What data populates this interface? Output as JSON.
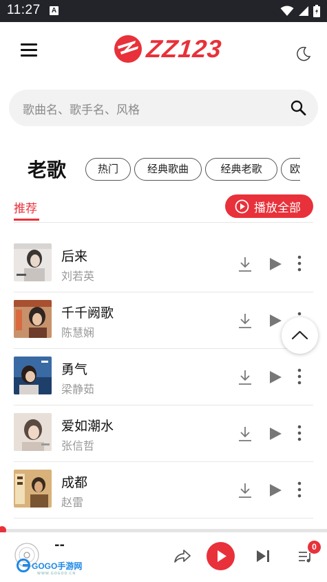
{
  "status_bar": {
    "time": "11:27",
    "notif_glyph": "A"
  },
  "header": {
    "logo_text": "ZZ123"
  },
  "search": {
    "placeholder": "歌曲名、歌手名、风格"
  },
  "category": {
    "title": "老歌",
    "tags": [
      "热门",
      "经典歌曲",
      "经典老歌",
      "欧"
    ]
  },
  "tabs": {
    "active": "推荐"
  },
  "play_all_label": "播放全部",
  "songs": [
    {
      "title": "后来",
      "artist": "刘若英"
    },
    {
      "title": "千千阙歌",
      "artist": "陈慧娴"
    },
    {
      "title": "勇气",
      "artist": "梁静茹"
    },
    {
      "title": "爱如潮水",
      "artist": "张信哲"
    },
    {
      "title": "成都",
      "artist": "赵雷"
    }
  ],
  "player": {
    "now_playing": "--",
    "queue_count": "0",
    "progress": 0,
    "watermark": "GOGO手游网",
    "watermark_sub": "WWW.GOGOD.CN"
  },
  "colors": {
    "accent": "#e8313a",
    "status_bar": "#22242a"
  }
}
